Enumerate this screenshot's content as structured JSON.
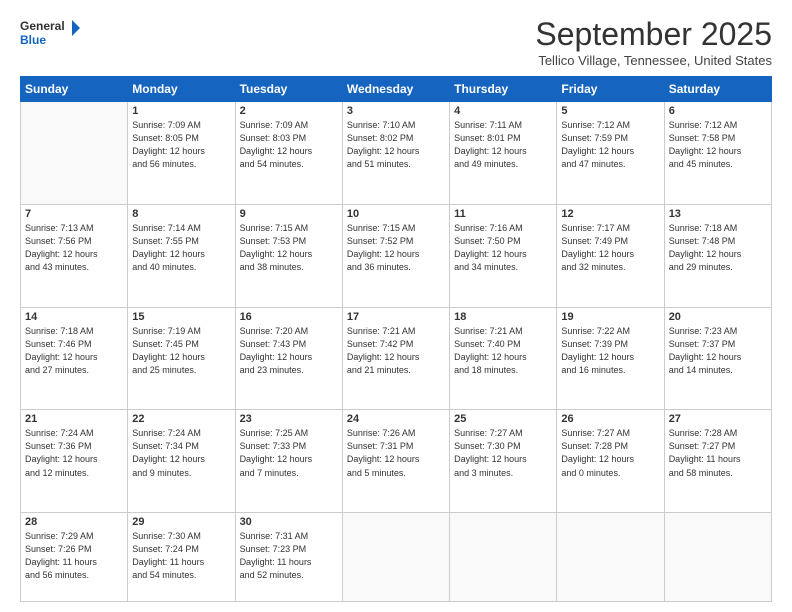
{
  "header": {
    "logo_line1": "General",
    "logo_line2": "Blue",
    "month": "September 2025",
    "location": "Tellico Village, Tennessee, United States"
  },
  "weekdays": [
    "Sunday",
    "Monday",
    "Tuesday",
    "Wednesday",
    "Thursday",
    "Friday",
    "Saturday"
  ],
  "weeks": [
    [
      {
        "day": "",
        "info": ""
      },
      {
        "day": "1",
        "info": "Sunrise: 7:09 AM\nSunset: 8:05 PM\nDaylight: 12 hours\nand 56 minutes."
      },
      {
        "day": "2",
        "info": "Sunrise: 7:09 AM\nSunset: 8:03 PM\nDaylight: 12 hours\nand 54 minutes."
      },
      {
        "day": "3",
        "info": "Sunrise: 7:10 AM\nSunset: 8:02 PM\nDaylight: 12 hours\nand 51 minutes."
      },
      {
        "day": "4",
        "info": "Sunrise: 7:11 AM\nSunset: 8:01 PM\nDaylight: 12 hours\nand 49 minutes."
      },
      {
        "day": "5",
        "info": "Sunrise: 7:12 AM\nSunset: 7:59 PM\nDaylight: 12 hours\nand 47 minutes."
      },
      {
        "day": "6",
        "info": "Sunrise: 7:12 AM\nSunset: 7:58 PM\nDaylight: 12 hours\nand 45 minutes."
      }
    ],
    [
      {
        "day": "7",
        "info": "Sunrise: 7:13 AM\nSunset: 7:56 PM\nDaylight: 12 hours\nand 43 minutes."
      },
      {
        "day": "8",
        "info": "Sunrise: 7:14 AM\nSunset: 7:55 PM\nDaylight: 12 hours\nand 40 minutes."
      },
      {
        "day": "9",
        "info": "Sunrise: 7:15 AM\nSunset: 7:53 PM\nDaylight: 12 hours\nand 38 minutes."
      },
      {
        "day": "10",
        "info": "Sunrise: 7:15 AM\nSunset: 7:52 PM\nDaylight: 12 hours\nand 36 minutes."
      },
      {
        "day": "11",
        "info": "Sunrise: 7:16 AM\nSunset: 7:50 PM\nDaylight: 12 hours\nand 34 minutes."
      },
      {
        "day": "12",
        "info": "Sunrise: 7:17 AM\nSunset: 7:49 PM\nDaylight: 12 hours\nand 32 minutes."
      },
      {
        "day": "13",
        "info": "Sunrise: 7:18 AM\nSunset: 7:48 PM\nDaylight: 12 hours\nand 29 minutes."
      }
    ],
    [
      {
        "day": "14",
        "info": "Sunrise: 7:18 AM\nSunset: 7:46 PM\nDaylight: 12 hours\nand 27 minutes."
      },
      {
        "day": "15",
        "info": "Sunrise: 7:19 AM\nSunset: 7:45 PM\nDaylight: 12 hours\nand 25 minutes."
      },
      {
        "day": "16",
        "info": "Sunrise: 7:20 AM\nSunset: 7:43 PM\nDaylight: 12 hours\nand 23 minutes."
      },
      {
        "day": "17",
        "info": "Sunrise: 7:21 AM\nSunset: 7:42 PM\nDaylight: 12 hours\nand 21 minutes."
      },
      {
        "day": "18",
        "info": "Sunrise: 7:21 AM\nSunset: 7:40 PM\nDaylight: 12 hours\nand 18 minutes."
      },
      {
        "day": "19",
        "info": "Sunrise: 7:22 AM\nSunset: 7:39 PM\nDaylight: 12 hours\nand 16 minutes."
      },
      {
        "day": "20",
        "info": "Sunrise: 7:23 AM\nSunset: 7:37 PM\nDaylight: 12 hours\nand 14 minutes."
      }
    ],
    [
      {
        "day": "21",
        "info": "Sunrise: 7:24 AM\nSunset: 7:36 PM\nDaylight: 12 hours\nand 12 minutes."
      },
      {
        "day": "22",
        "info": "Sunrise: 7:24 AM\nSunset: 7:34 PM\nDaylight: 12 hours\nand 9 minutes."
      },
      {
        "day": "23",
        "info": "Sunrise: 7:25 AM\nSunset: 7:33 PM\nDaylight: 12 hours\nand 7 minutes."
      },
      {
        "day": "24",
        "info": "Sunrise: 7:26 AM\nSunset: 7:31 PM\nDaylight: 12 hours\nand 5 minutes."
      },
      {
        "day": "25",
        "info": "Sunrise: 7:27 AM\nSunset: 7:30 PM\nDaylight: 12 hours\nand 3 minutes."
      },
      {
        "day": "26",
        "info": "Sunrise: 7:27 AM\nSunset: 7:28 PM\nDaylight: 12 hours\nand 0 minutes."
      },
      {
        "day": "27",
        "info": "Sunrise: 7:28 AM\nSunset: 7:27 PM\nDaylight: 11 hours\nand 58 minutes."
      }
    ],
    [
      {
        "day": "28",
        "info": "Sunrise: 7:29 AM\nSunset: 7:26 PM\nDaylight: 11 hours\nand 56 minutes."
      },
      {
        "day": "29",
        "info": "Sunrise: 7:30 AM\nSunset: 7:24 PM\nDaylight: 11 hours\nand 54 minutes."
      },
      {
        "day": "30",
        "info": "Sunrise: 7:31 AM\nSunset: 7:23 PM\nDaylight: 11 hours\nand 52 minutes."
      },
      {
        "day": "",
        "info": ""
      },
      {
        "day": "",
        "info": ""
      },
      {
        "day": "",
        "info": ""
      },
      {
        "day": "",
        "info": ""
      }
    ]
  ]
}
